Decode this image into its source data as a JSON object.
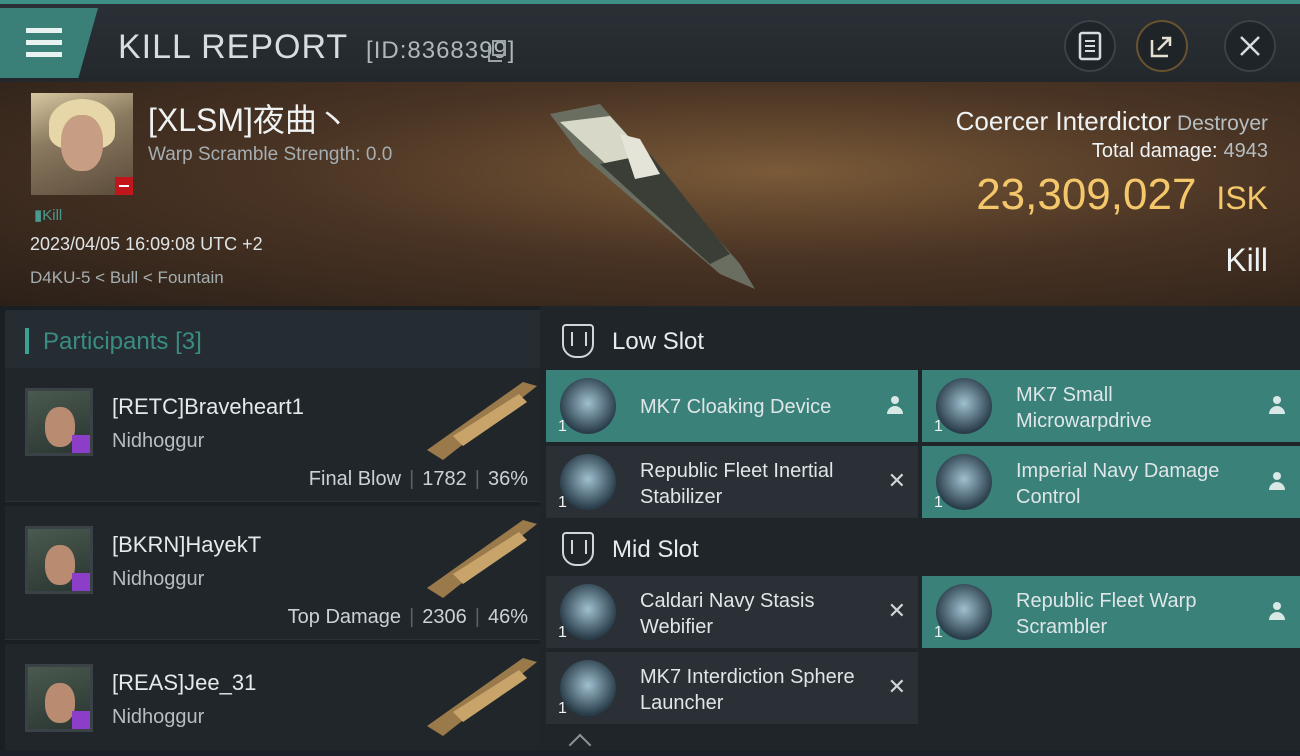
{
  "header": {
    "title": "KILL REPORT",
    "report_id": "[ID:8368399]"
  },
  "victim": {
    "pilot": "[XLSM]夜曲丶",
    "warp_scramble": "Warp Scramble Strength: 0.0",
    "tag": "Kill",
    "datetime": "2023/04/05 16:09:08 UTC +2",
    "location": "D4KU-5 < Bull < Fountain",
    "ship_name": "Coercer Interdictor",
    "ship_class": "Destroyer",
    "total_damage_label": "Total damage:",
    "total_damage": "4943",
    "isk_value": "23,309,027",
    "isk_unit": "ISK",
    "result": "Kill"
  },
  "participants": {
    "label": "Participants",
    "count": "[3]",
    "list": [
      {
        "name": "[RETC]Braveheart1",
        "ship": "Nidhoggur",
        "role": "Final Blow",
        "damage": "1782",
        "percent": "36%"
      },
      {
        "name": "[BKRN]HayekT",
        "ship": "Nidhoggur",
        "role": "Top Damage",
        "damage": "2306",
        "percent": "46%"
      },
      {
        "name": "[REAS]Jee_31",
        "ship": "Nidhoggur",
        "role": "",
        "damage": "",
        "percent": ""
      }
    ]
  },
  "slots": {
    "low_label": "Low Slot",
    "mid_label": "Mid Slot",
    "low": [
      {
        "name": "MK7 Cloaking Device",
        "qty": "1",
        "status": "dropped"
      },
      {
        "name": "MK7 Small Microwarpdrive",
        "qty": "1",
        "status": "dropped"
      },
      {
        "name": "Republic Fleet Inertial Stabilizer",
        "qty": "1",
        "status": "destroyed"
      },
      {
        "name": "Imperial Navy Damage Control",
        "qty": "1",
        "status": "dropped"
      }
    ],
    "mid": [
      {
        "name": "Caldari Navy Stasis Webifier",
        "qty": "1",
        "status": "destroyed"
      },
      {
        "name": "Republic Fleet Warp Scrambler",
        "qty": "1",
        "status": "dropped"
      },
      {
        "name": "MK7 Interdiction Sphere Launcher",
        "qty": "1",
        "status": "destroyed"
      }
    ]
  },
  "icons": {
    "menu": "hamburger-icon",
    "copy": "copy-icon",
    "report": "document-icon",
    "share": "share-icon",
    "close": "close-icon",
    "dropped": "person-icon",
    "destroyed": "x-icon"
  },
  "colors": {
    "accent": "#3a8179",
    "isk": "#f3c76a",
    "security_badge": "#c0161c",
    "participant_badge": "#8c3ec8"
  }
}
